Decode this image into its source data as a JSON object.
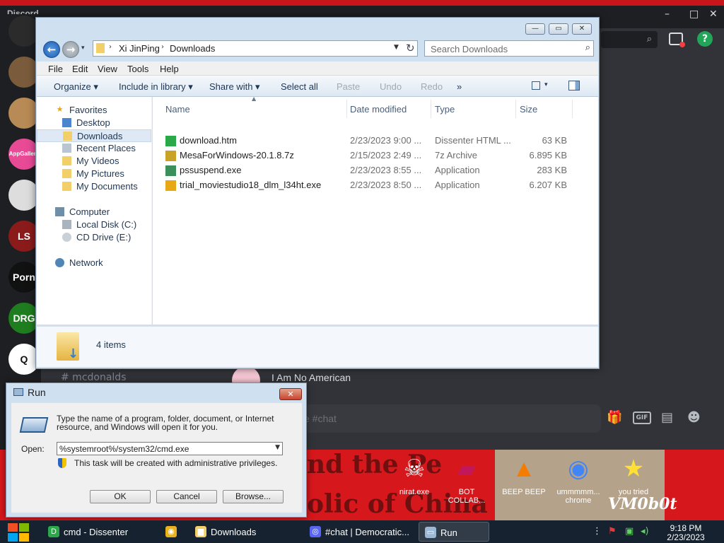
{
  "discord": {
    "brand": "Discord",
    "channel": "# mcdonalds",
    "message": "I Am No American",
    "input_placeholder": "e #chat",
    "window_controls": [
      "–",
      "□",
      "✕"
    ],
    "servers": [
      {
        "name": "server-icon-1",
        "color": "#2b2b2b",
        "label": ""
      },
      {
        "name": "server-icon-2",
        "color": "#7a5b3c",
        "label": ""
      },
      {
        "name": "server-icon-3",
        "color": "#b88a55",
        "label": ""
      },
      {
        "name": "server-icon-4",
        "color": "#e84a96",
        "label": "AppGallery"
      },
      {
        "name": "server-icon-5",
        "color": "#ddd",
        "label": ""
      },
      {
        "name": "server-icon-6",
        "color": "#8b1b1b",
        "label": "LS"
      },
      {
        "name": "server-icon-7",
        "color": "#111",
        "label": "Porn"
      },
      {
        "name": "server-icon-8",
        "color": "#1e7d1e",
        "label": "DRG"
      },
      {
        "name": "server-icon-9",
        "color": "#fff",
        "label": "Q"
      }
    ]
  },
  "wallpaper": {
    "line1": "nd the Pe",
    "line2": "olic of China",
    "signature": "VM0b0t"
  },
  "desktop_icons": [
    {
      "label": "nirat.exe",
      "glyph": "☠"
    },
    {
      "label": "BOT COLLAB...",
      "glyph": "▰"
    },
    {
      "label": "BEEP BEEP",
      "glyph": "▲"
    },
    {
      "label": "ummmmm... chrome",
      "glyph": "◉"
    },
    {
      "label": "you tried",
      "glyph": "★"
    }
  ],
  "explorer": {
    "window_buttons": [
      "—",
      "▭",
      "✕"
    ],
    "address": {
      "segments": [
        "Xi JinPing",
        "Downloads"
      ]
    },
    "search_placeholder": "Search Downloads",
    "menu": [
      "File",
      "Edit",
      "View",
      "Tools",
      "Help"
    ],
    "commands": [
      {
        "label": "Organize ▾",
        "disabled": false
      },
      {
        "label": "Include in library ▾",
        "disabled": false
      },
      {
        "label": "Share with ▾",
        "disabled": false
      },
      {
        "label": "Select all",
        "disabled": false
      },
      {
        "label": "Paste",
        "disabled": true
      },
      {
        "label": "Undo",
        "disabled": true
      },
      {
        "label": "Redo",
        "disabled": true
      },
      {
        "label": "»",
        "disabled": false
      }
    ],
    "nav": {
      "favorites_label": "Favorites",
      "favorites": [
        "Desktop",
        "Downloads",
        "Recent Places",
        "My Videos",
        "My Pictures",
        "My Documents"
      ],
      "selected": "Downloads",
      "computer_label": "Computer",
      "drives": [
        "Local Disk (C:)",
        "CD Drive (E:)"
      ],
      "network_label": "Network"
    },
    "columns": [
      "Name",
      "Date modified",
      "Type",
      "Size"
    ],
    "files": [
      {
        "name": "download.htm",
        "date": "2/23/2023 9:00 ...",
        "type": "Dissenter HTML ...",
        "size": "63 KB",
        "icon_color": "#2aa84a"
      },
      {
        "name": "MesaForWindows-20.1.8.7z",
        "date": "2/15/2023 2:49 ...",
        "type": "7z Archive",
        "size": "6.895 KB",
        "icon_color": "#c9a227"
      },
      {
        "name": "pssuspend.exe",
        "date": "2/23/2023 8:55 ...",
        "type": "Application",
        "size": "283 KB",
        "icon_color": "#3a8f5a"
      },
      {
        "name": "trial_moviestudio18_dlm_l34ht.exe",
        "date": "2/23/2023 8:50 ...",
        "type": "Application",
        "size": "6.207 KB",
        "icon_color": "#e6a817"
      }
    ],
    "item_count": "4 items"
  },
  "run_dialog": {
    "title": "Run",
    "description": "Type the name of a program, folder, document, or Internet resource, and Windows will open it for you.",
    "open_label": "Open:",
    "open_value": "%systemroot%/system32/cmd.exe",
    "admin_note": "This task will be created with administrative privileges.",
    "buttons": {
      "ok": "OK",
      "cancel": "Cancel",
      "browse": "Browse..."
    }
  },
  "taskbar": {
    "items": [
      {
        "label": "cmd - Dissenter",
        "icon": "D",
        "icon_color": "#2aa84a"
      },
      {
        "label": "",
        "icon": "◉",
        "icon_color": "#e9b21c"
      },
      {
        "label": "Downloads",
        "icon": "▆",
        "icon_color": "#f2cf68"
      },
      {
        "label": "#chat | Democratic...",
        "icon": "◎",
        "icon_color": "#5865f2"
      },
      {
        "label": "Run",
        "icon": "▭",
        "icon_color": "#9bb8d6"
      }
    ],
    "clock_time": "9:18 PM",
    "clock_date": "2/23/2023"
  }
}
